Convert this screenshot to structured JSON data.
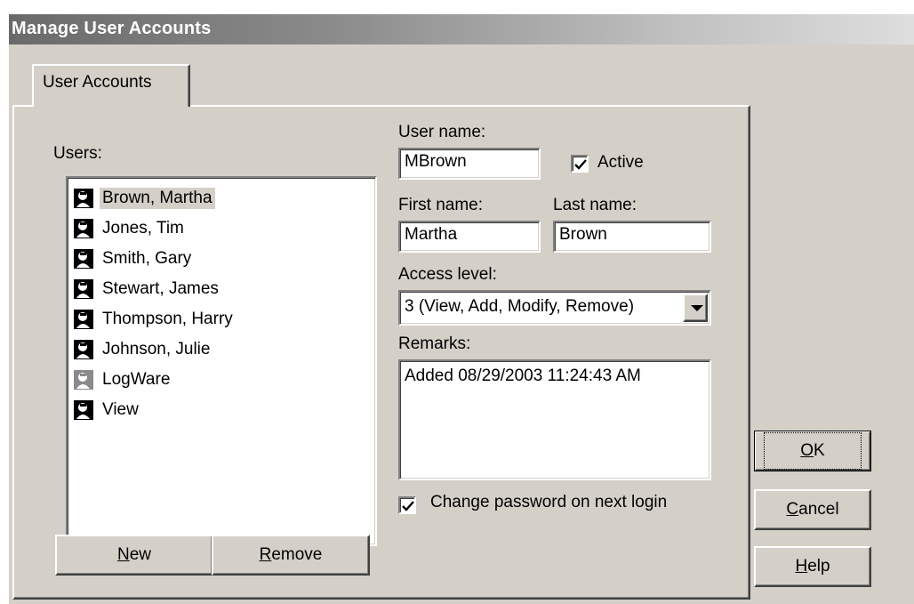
{
  "window": {
    "title": "Manage User Accounts"
  },
  "tabs": [
    {
      "label": "User Accounts"
    }
  ],
  "users": {
    "label": "Users:",
    "items": [
      {
        "name": "Brown, Martha",
        "selected": true,
        "icon": "user-icon"
      },
      {
        "name": "Jones, Tim",
        "selected": false,
        "icon": "user-icon"
      },
      {
        "name": "Smith, Gary",
        "selected": false,
        "icon": "user-icon"
      },
      {
        "name": "Stewart, James",
        "selected": false,
        "icon": "user-icon"
      },
      {
        "name": "Thompson, Harry",
        "selected": false,
        "icon": "user-icon"
      },
      {
        "name": "Johnson, Julie",
        "selected": false,
        "icon": "user-icon"
      },
      {
        "name": "LogWare",
        "selected": false,
        "icon": "user-icon-disabled"
      },
      {
        "name": "View",
        "selected": false,
        "icon": "user-icon"
      }
    ],
    "new_button": {
      "mnemonic": "N",
      "rest": "ew"
    },
    "remove_button": {
      "mnemonic": "R",
      "rest": "emove"
    }
  },
  "form": {
    "username_label": "User name:",
    "username_value": "MBrown",
    "active_label": "Active",
    "active_checked": true,
    "firstname_label": "First name:",
    "firstname_value": "Martha",
    "lastname_label": "Last name:",
    "lastname_value": "Brown",
    "access_label": "Access level:",
    "access_value": "3 (View, Add, Modify, Remove)",
    "remarks_label": "Remarks:",
    "remarks_value": "Added 08/29/2003 11:24:43 AM",
    "change_password_label": "Change password on next login",
    "change_password_checked": true
  },
  "buttons": {
    "ok": {
      "mnemonic": "O",
      "rest": "K"
    },
    "cancel": {
      "mnemonic": "C",
      "rest": "ancel"
    },
    "help": {
      "mnemonic": "H",
      "rest": "elp"
    }
  },
  "colors": {
    "face": "#d4d0c8",
    "selected_bg": "#d4d0c8",
    "title_gradient_start": "#6a6a6a",
    "title_gradient_end": "#dedede"
  }
}
